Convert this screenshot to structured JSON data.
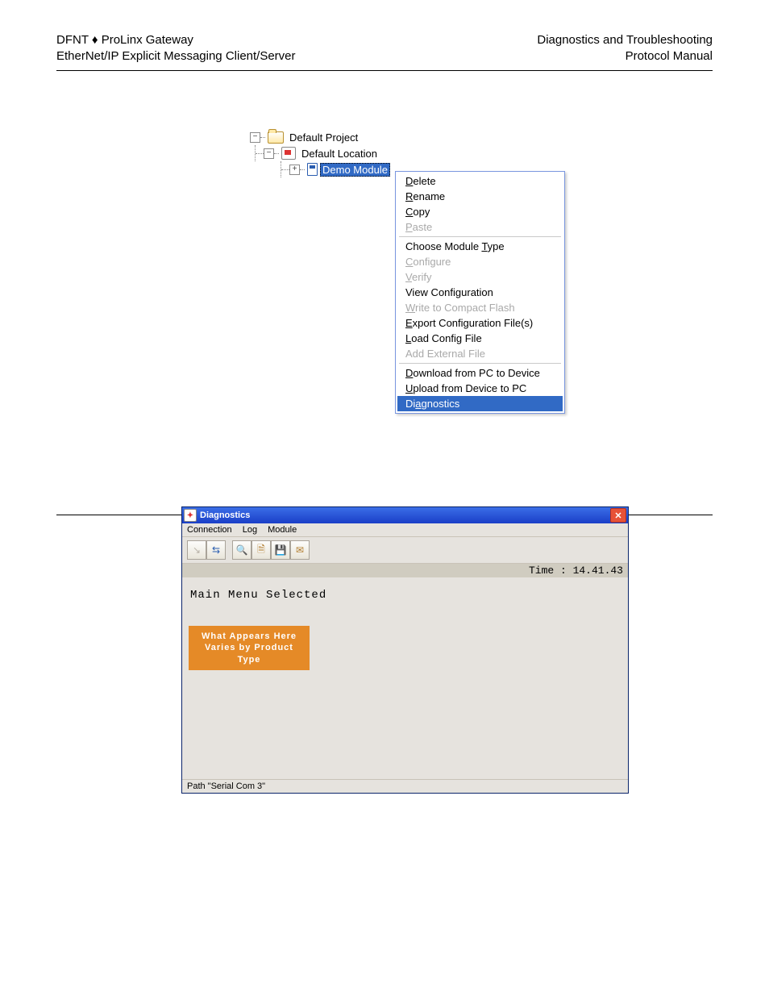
{
  "header": {
    "left1": "DFNT ♦ ProLinx Gateway",
    "left2": "EtherNet/IP Explicit Messaging Client/Server",
    "right1": "Diagnostics and Troubleshooting",
    "right2": "Protocol Manual"
  },
  "tree": {
    "project": "Default Project",
    "location": "Default Location",
    "module": "Demo Module"
  },
  "ctx": {
    "delete_pre": "D",
    "delete": "elete",
    "rename_pre": "R",
    "rename": "ename",
    "copy_pre": "C",
    "copy": "opy",
    "paste_pre": "P",
    "paste": "aste",
    "cmt_pre": "Choose Module ",
    "cmt_u": "T",
    "cmt_post": "ype",
    "conf_pre": "C",
    "conf": "onfigure",
    "ver_pre": "V",
    "ver": "erify",
    "viewconf": "View Configuration",
    "wcf_pre": "W",
    "wcf": "rite to Compact Flash",
    "exp_pre": "E",
    "exp": "xport Configuration File(s)",
    "lcf_pre": "L",
    "lcf": "oad Config File",
    "aef": "Add External File",
    "dl_pre": "D",
    "dl": "ownload from PC to Device",
    "ul_pre": "U",
    "ul": "pload from Device to PC",
    "diag_pre": "Di",
    "diag_u": "a",
    "diag_post": "gnostics"
  },
  "diag": {
    "title": "Diagnostics",
    "menu_conn": "Connection",
    "menu_log": "Log",
    "menu_mod": "Module",
    "time": "Time : 14.41.43",
    "mainmenu": "Main Menu Selected",
    "orange1": "What Appears Here",
    "orange2": "Varies by Product Type",
    "status": "Path \"Serial Com 3\""
  }
}
